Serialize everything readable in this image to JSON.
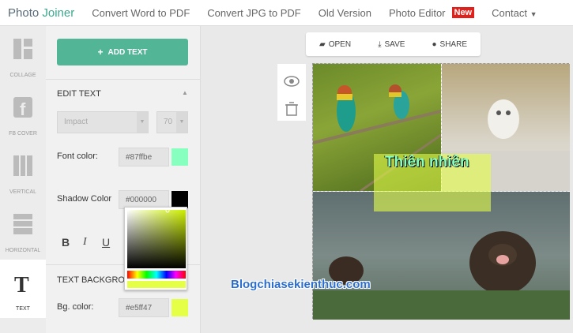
{
  "nav": {
    "logo_a": "Photo",
    "logo_b": "Joiner",
    "links": [
      "Convert Word to PDF",
      "Convert JPG to PDF",
      "Old Version",
      "Photo Editor"
    ],
    "new_badge": "New",
    "contact": "Contact"
  },
  "rail": {
    "items": [
      {
        "label": "COLLAGE",
        "icon": "collage-icon"
      },
      {
        "label": "FB COVER",
        "icon": "facebook-icon"
      },
      {
        "label": "VERTICAL",
        "icon": "vertical-icon"
      },
      {
        "label": "HORIZONTAL",
        "icon": "horizontal-icon"
      },
      {
        "label": "TEXT",
        "icon": "text-icon"
      }
    ],
    "active": "TEXT"
  },
  "panel": {
    "add_text": "ADD TEXT",
    "edit_text_title": "EDIT TEXT",
    "font_family": "Impact",
    "font_size": "70",
    "font_color_label": "Font color:",
    "font_color_value": "#87ffbe",
    "shadow_color_label": "Shadow Color",
    "shadow_color_value": "#000000",
    "format": {
      "bold": "B",
      "italic": "I",
      "underline": "U"
    },
    "text_bg_title": "TEXT BACKGROU",
    "bg_color_label": "Bg. color:",
    "bg_color_value": "#e5ff47"
  },
  "toolbar": {
    "open": "OPEN",
    "save": "SAVE",
    "share": "SHARE"
  },
  "canvas": {
    "overlay_text": "Thiên nhiên",
    "watermark": "Blogchiasekienthuc.com"
  },
  "colors": {
    "accent": "#52b596",
    "new_badge": "#e0201b",
    "font_color": "#87ffbe",
    "shadow_color": "#000000",
    "bg_color": "#e5ff47"
  }
}
